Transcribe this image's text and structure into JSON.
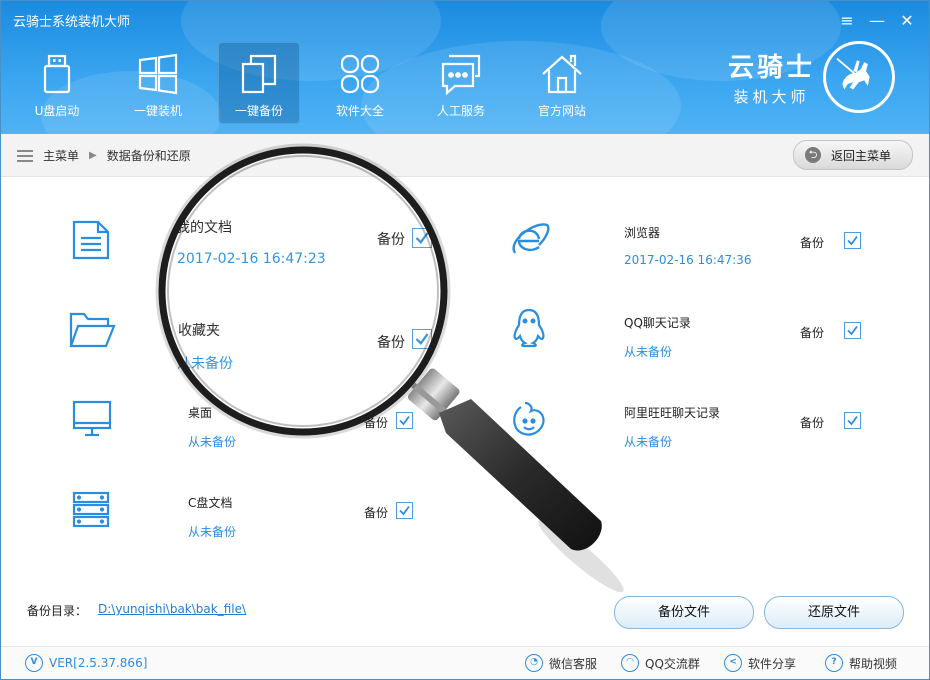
{
  "app": {
    "title": "云骑士系统装机大师"
  },
  "window_controls": {
    "menu": "≡",
    "minimize": "—",
    "close": "✕"
  },
  "nav": [
    {
      "label": "U盘启动",
      "icon": "usb-drive-icon"
    },
    {
      "label": "一键装机",
      "icon": "windows-icon"
    },
    {
      "label": "一键备份",
      "icon": "copy-icon",
      "active": true
    },
    {
      "label": "软件大全",
      "icon": "apps-grid-icon"
    },
    {
      "label": "人工服务",
      "icon": "chat-icon"
    },
    {
      "label": "官方网站",
      "icon": "home-icon"
    }
  ],
  "brand": {
    "name": "云骑士",
    "sub": "装机大师"
  },
  "breadcrumb": {
    "root": "主菜单",
    "current": "数据备份和还原",
    "back_button": "返回主菜单"
  },
  "backup_items": [
    {
      "name": "我的文档",
      "status": "2017-02-16 16:47:23",
      "action": "备份",
      "checked": true,
      "icon": "document-icon"
    },
    {
      "name": "收藏夹",
      "status": "从未备份",
      "action": "备份",
      "checked": true,
      "icon": "folder-icon"
    },
    {
      "name": "桌面",
      "status": "从未备份",
      "action": "备份",
      "checked": true,
      "icon": "monitor-icon"
    },
    {
      "name": "C盘文档",
      "status": "从未备份",
      "action": "备份",
      "checked": true,
      "icon": "server-icon"
    },
    {
      "name": "浏览器",
      "status": "2017-02-16 16:47:36",
      "action": "备份",
      "checked": true,
      "icon": "ie-browser-icon"
    },
    {
      "name": "QQ聊天记录",
      "status": "从未备份",
      "action": "备份",
      "checked": true,
      "icon": "qq-penguin-icon"
    },
    {
      "name": "阿里旺旺聊天记录",
      "status": "从未备份",
      "action": "备份",
      "checked": true,
      "icon": "wangwang-icon"
    }
  ],
  "backup_dir": {
    "label": "备份目录：",
    "path": "D:\\yunqishi\\bak\\bak_file\\"
  },
  "buttons": {
    "backup": "备份文件",
    "restore": "还原文件"
  },
  "footer": {
    "version": "VER[2.5.37.866]",
    "links": [
      "微信客服",
      "QQ交流群",
      "软件分享",
      "帮助视频"
    ]
  },
  "colors": {
    "header": "#2a98ea",
    "accent": "#2a8ee0"
  }
}
